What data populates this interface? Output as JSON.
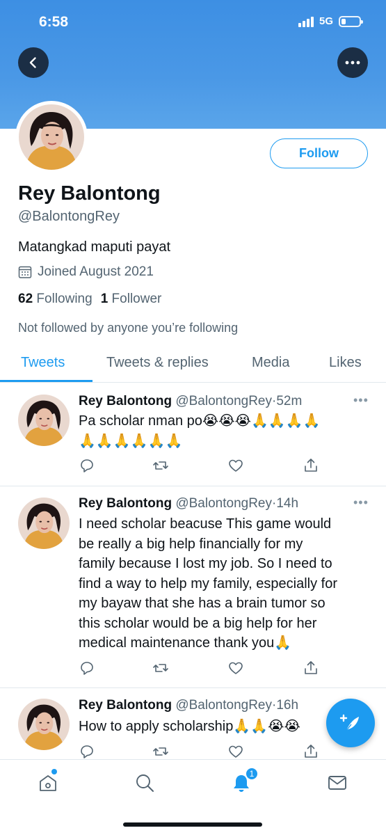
{
  "status_bar": {
    "time": "6:58",
    "network": "5G"
  },
  "profile": {
    "name": "Rey Balontong",
    "handle": "@BalontongRey",
    "bio": "Matangkad maputi payat",
    "joined": "Joined August 2021",
    "following_count": "62",
    "following_label": "Following",
    "follower_count": "1",
    "follower_label": "Follower",
    "not_followed_note": "Not followed by anyone you’re following",
    "follow_button": "Follow"
  },
  "tabs": [
    {
      "label": "Tweets",
      "active": true
    },
    {
      "label": "Tweets & replies",
      "active": false
    },
    {
      "label": "Media",
      "active": false
    },
    {
      "label": "Likes",
      "active": false
    }
  ],
  "tweets": [
    {
      "name": "Rey Balontong",
      "handle_time": "@BalontongRey·52m",
      "text": "Pa scholar nman po😭😭😭🙏🙏🙏🙏\n🙏🙏🙏🙏🙏🙏"
    },
    {
      "name": "Rey Balontong",
      "handle_time": "@BalontongRey·14h",
      "text": "I need scholar beacuse This game would\nbe really a big help financially for my\nfamily because I lost my job. So I need to\nfind a way to help my family, especially for\nmy bayaw that she has a brain tumor so\nthis scholar would be a big help for her\nmedical maintenance thank you🙏"
    },
    {
      "name": "Rey Balontong",
      "handle_time": "@BalontongRey·16h",
      "text": "How to apply scholarship🙏🙏😭😭"
    }
  ],
  "notifications_badge": "1",
  "colors": {
    "accent": "#1d9bf0",
    "banner": "#4a98e6",
    "dark_button": "#1b2e45"
  }
}
